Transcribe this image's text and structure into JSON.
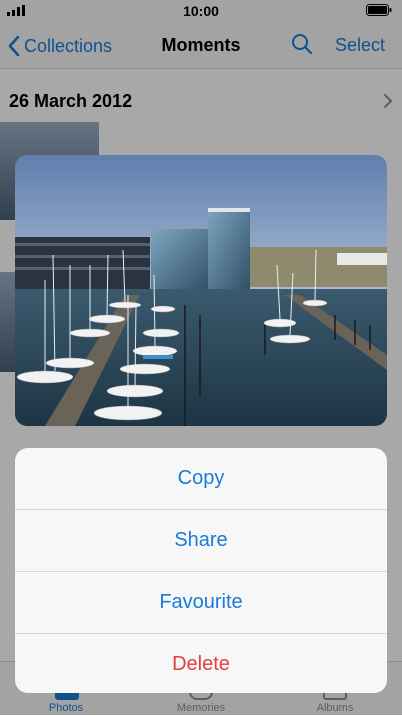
{
  "status_bar": {
    "time": "10:00",
    "signal_icon": "signal-bars-icon",
    "battery_icon": "battery-icon"
  },
  "nav": {
    "back_label": "Collections",
    "title": "Moments",
    "search_icon": "search-icon",
    "select_label": "Select"
  },
  "content": {
    "section_date": "26 March 2012"
  },
  "tab_bar": {
    "items": [
      {
        "label": "Photos",
        "active": true
      },
      {
        "label": "Memories",
        "active": false
      },
      {
        "label": "Albums",
        "active": false
      }
    ]
  },
  "action_sheet": {
    "actions": [
      {
        "label": "Copy",
        "style": "default"
      },
      {
        "label": "Share",
        "style": "default"
      },
      {
        "label": "Favourite",
        "style": "default"
      },
      {
        "label": "Delete",
        "style": "destructive"
      }
    ]
  },
  "colors": {
    "accent": "#1a7bd8",
    "destructive": "#e3403b"
  }
}
